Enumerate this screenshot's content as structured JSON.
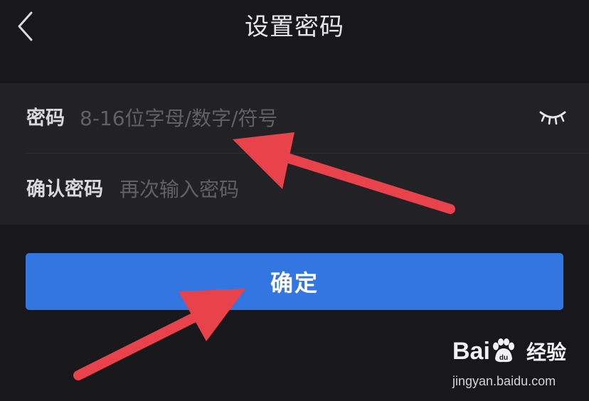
{
  "header": {
    "title": "设置密码",
    "back_icon": "chevron-left-icon"
  },
  "form": {
    "password": {
      "label": "密码",
      "placeholder": "8-16位字母/数字/符号",
      "value": "",
      "visibility_icon": "eye-closed-icon"
    },
    "confirm_password": {
      "label": "确认密码",
      "placeholder": "再次输入密码",
      "value": ""
    }
  },
  "actions": {
    "confirm_label": "确定"
  },
  "annotations": {
    "arrow_color": "#e8434a"
  },
  "watermark": {
    "brand": "Bai",
    "paw_text": "du",
    "product": "经验",
    "url": "jingyan.baidu.com"
  },
  "colors": {
    "background": "#18181c",
    "form_background": "#222226",
    "accent": "#3476e1"
  }
}
